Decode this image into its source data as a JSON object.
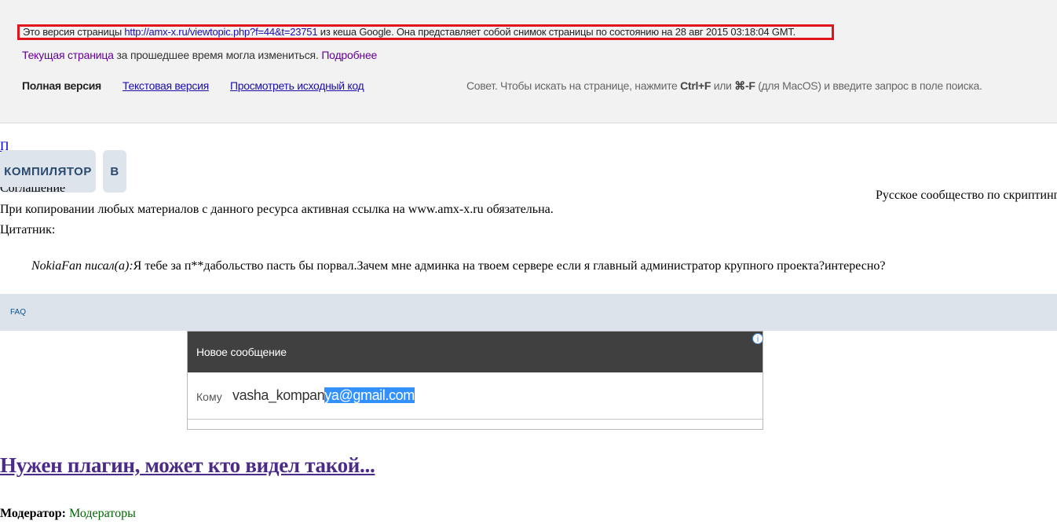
{
  "cache": {
    "notice_prefix": "Это версия страницы ",
    "notice_url": "http://amx-x.ru/viewtopic.php?f=44&t=23751",
    "notice_suffix": " из кеша Google. Она представляет собой снимок страницы по состоянию на 28 авг 2015 03:18:04 GMT.",
    "current_page_link": "Текущая страница",
    "current_page_text": " за прошедшее время могла измениться. ",
    "more_link": "Подробнее",
    "tabs": {
      "full": "Полная версия",
      "text": "Текстовая версия",
      "source": "Просмотреть исходный код"
    },
    "tip_prefix": "Совет. Чтобы искать на странице, нажмите ",
    "tip_key1": "Ctrl+F",
    "tip_mid": " или ",
    "tip_key2": "⌘-F",
    "tip_suffix": " (для MacOS) и введите запрос в поле поиска."
  },
  "page": {
    "clipped_link": "П",
    "nav_pill_1": "КОМПИЛЯТОР",
    "nav_pill_2": "В",
    "cut_text": "Соглашение",
    "right_text": "Русское сообщество по скриптинг",
    "copy_notice": "При копировании любых материалов с данного ресурса активная ссылка на www.amx-x.ru обязательна.",
    "quotes_label": "Цитатник:",
    "quote_author": "NokiaFan писал(а):",
    "quote_text": "Я тебе за п**дабольство пасть бы порвал.Зачем мне админка на твоем сервере если я главный администратор крупного проекта?интересно?",
    "faq": "FAQ",
    "topic_title": "Нужен плагин, может кто видел такой...",
    "moderator_label": "Модератор:",
    "moderator_value": "Модераторы"
  },
  "ad": {
    "header": "Новое сообщение",
    "to_label": "Кому",
    "to_plain": "vasha_kompan",
    "to_selected": "ya@gmail.com",
    "info_icon": "i"
  },
  "colors": {
    "notice_border": "#e3141c",
    "link_blue": "#1a0dab",
    "visited_purple": "#660099",
    "faq_bar": "#dce3ea"
  }
}
